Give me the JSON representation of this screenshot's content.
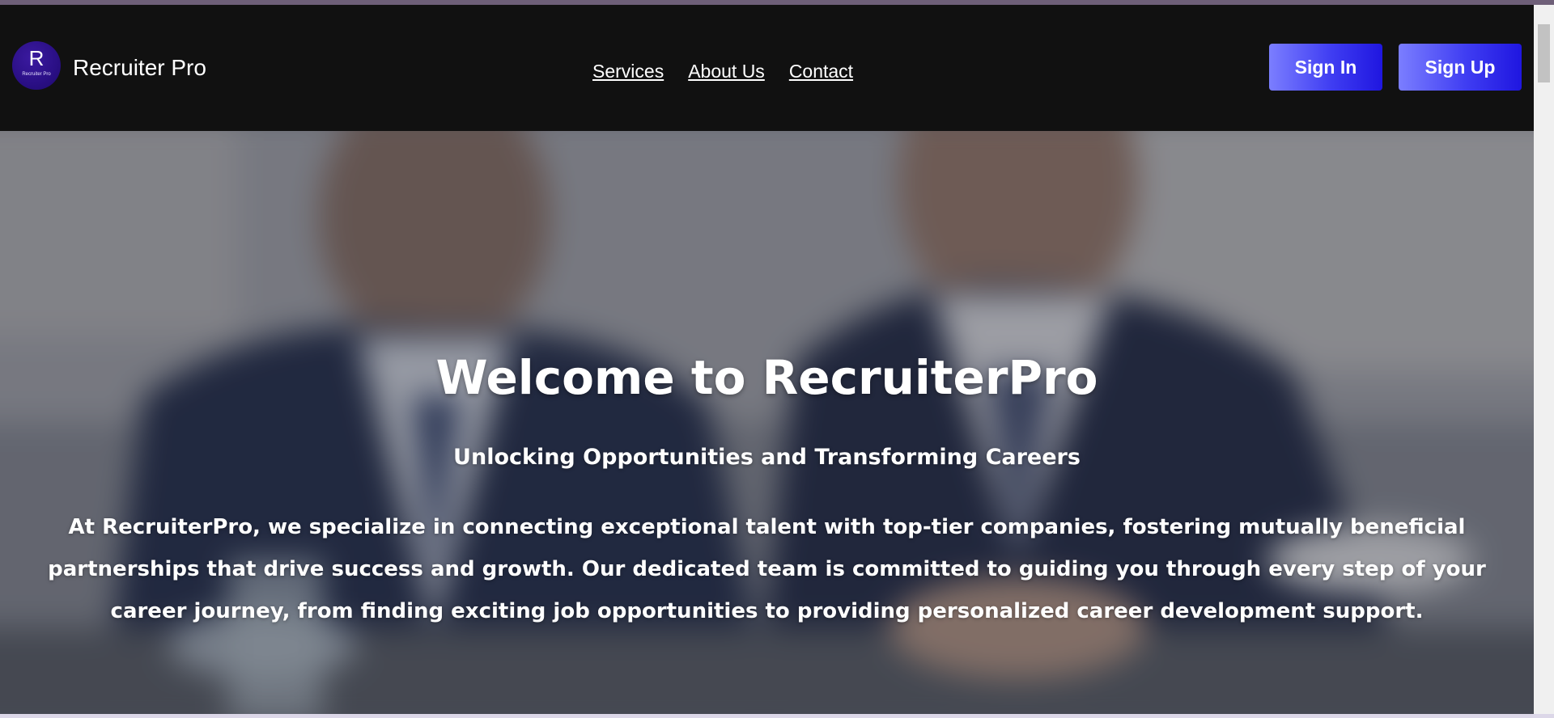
{
  "header": {
    "logo": {
      "letter": "R",
      "caption": "Recruiter Pro"
    },
    "brand_name": "Recruiter Pro",
    "nav": [
      {
        "label": "Services"
      },
      {
        "label": "About Us"
      },
      {
        "label": "Contact"
      }
    ],
    "sign_in_label": "Sign In",
    "sign_up_label": "Sign Up"
  },
  "hero": {
    "title": "Welcome to RecruiterPro",
    "subtitle": "Unlocking Opportunities and Transforming Careers",
    "body": "At RecruiterPro, we specialize in connecting exceptional talent with top-tier companies, fostering mutually beneficial partnerships that drive success and growth. Our dedicated team is committed to guiding you through every step of your career journey, from finding exciting job opportunities to providing personalized career development support."
  },
  "colors": {
    "navbar_background": "#111111",
    "button_gradient_start": "#7b7eff",
    "button_gradient_end": "#1f16e0",
    "logo_background": "#2a0f85",
    "text": "#ffffff"
  },
  "icons": {
    "logo": "recruiter-pro-logo"
  }
}
